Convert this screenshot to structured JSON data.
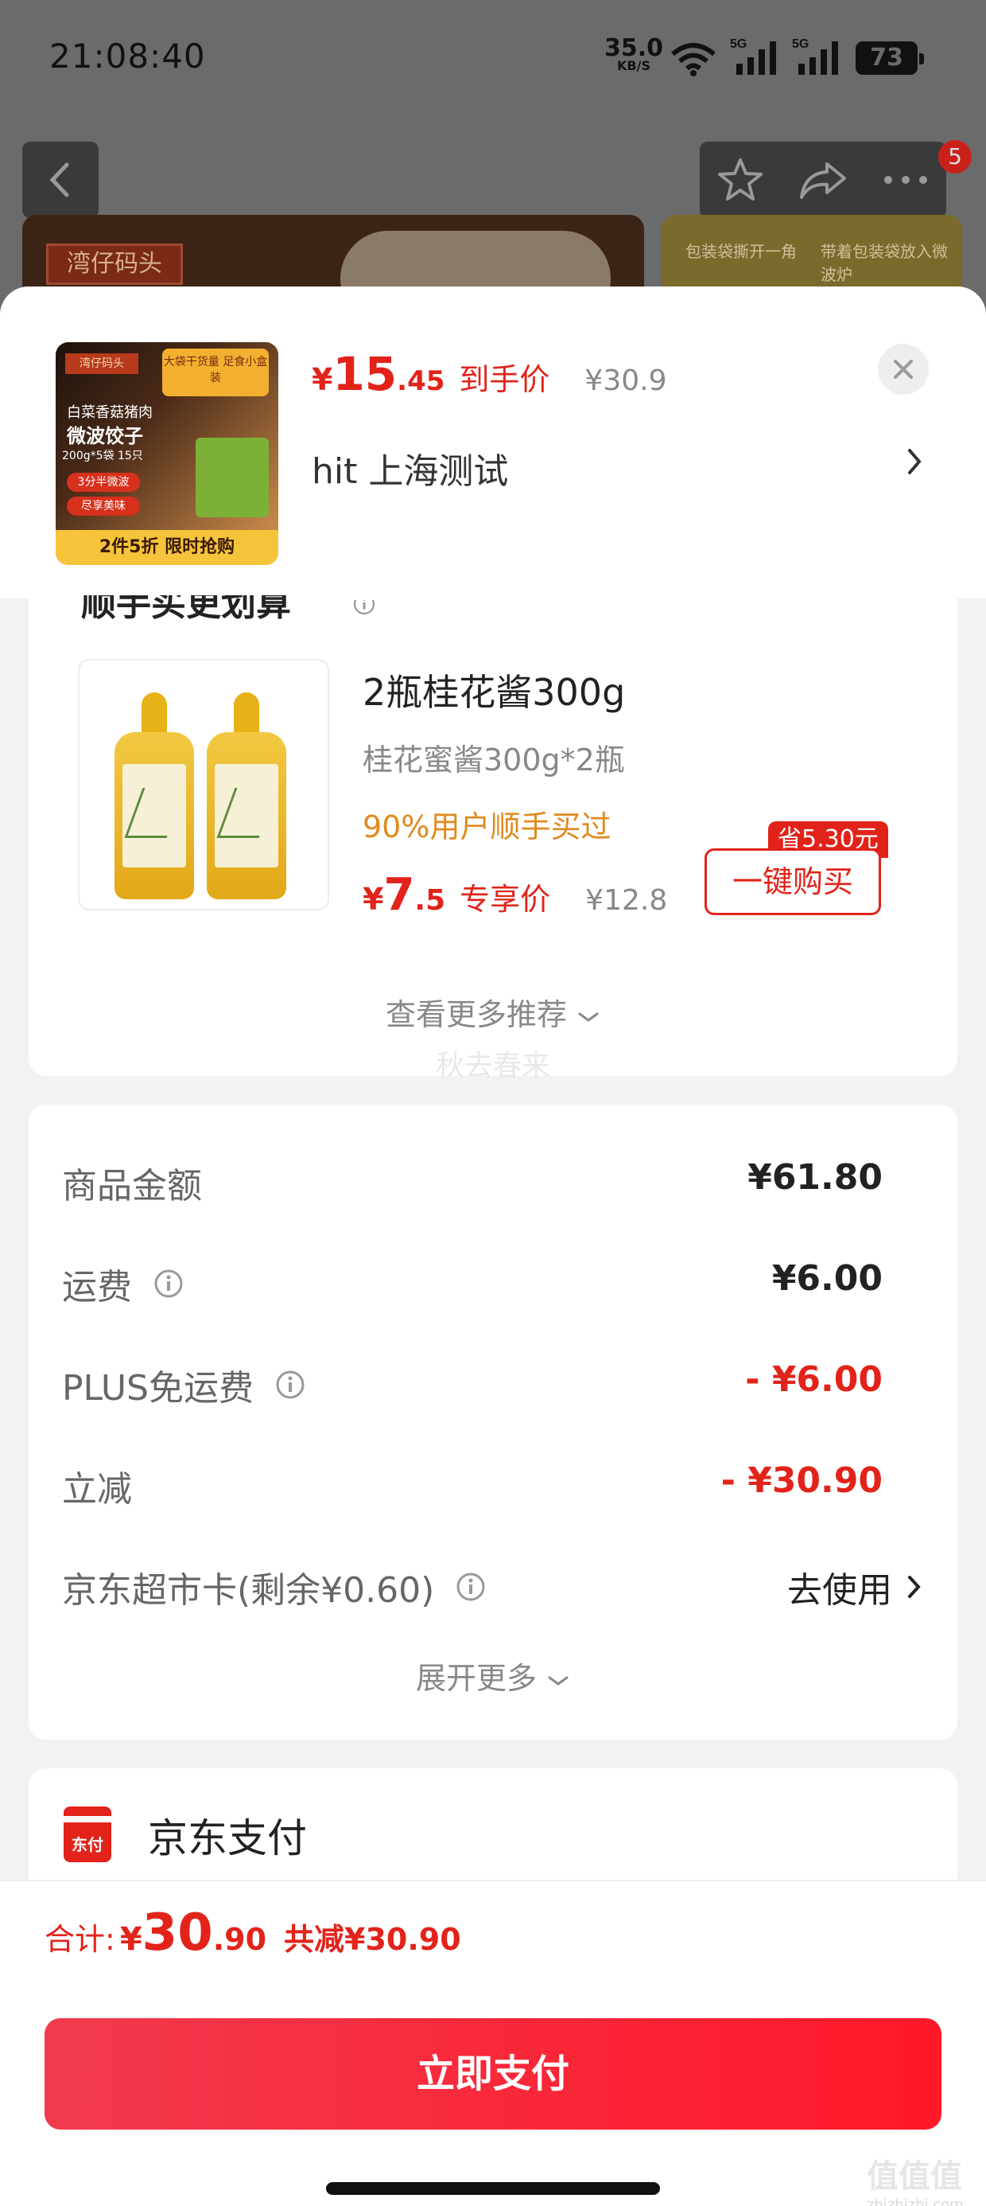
{
  "status_bar": {
    "time": "21:08:40",
    "net_speed": "35.0",
    "net_unit": "KB/S",
    "sim1": "5G",
    "sim2": "5G",
    "battery": "73"
  },
  "top_bar": {
    "notification_count": "5"
  },
  "background": {
    "brand_logo": "湾仔码头",
    "side_step1": "包装袋撕开一角",
    "side_step2": "带着包装袋放入微波炉"
  },
  "product": {
    "image_tag_brand": "湾仔码头",
    "image_title_line1": "白菜香菇猪肉",
    "image_title_line2": "微波饺子",
    "image_spec": "200g*5袋 15只",
    "image_tag1": "3分半微波",
    "image_tag2": "尽享美味",
    "image_badge": "大袋干货量 足食小盒装",
    "image_banner": "2件5折 限时抢购",
    "price_currency": "¥",
    "price_int": "15",
    "price_dec": ".45",
    "price_label": "到手价",
    "original_price": "¥30.9",
    "address": "hit  上海测试"
  },
  "recommend": {
    "section_title": "顺手买更划算",
    "item_name": "2瓶桂花酱300g",
    "item_spec": "桂花蜜酱300g*2瓶",
    "item_tip": "90%用户顺手买过",
    "price_currency": "¥",
    "price_int": "7",
    "price_dec": ".5",
    "price_label": "专享价",
    "original_price": "¥12.8",
    "save_tag": "省5.30元",
    "buy_label": "一键购买",
    "more_label": "查看更多推荐",
    "watermark": "秋去春来"
  },
  "summary": {
    "rows": [
      {
        "label": "商品金额",
        "value": "¥61.80"
      },
      {
        "label": "运费",
        "value": "¥6.00"
      },
      {
        "label": "PLUS免运费",
        "value": "- ¥6.00"
      },
      {
        "label": "立减",
        "value": "- ¥30.90"
      },
      {
        "label": "京东超市卡(剩余¥0.60)",
        "value": "去使用"
      }
    ],
    "expand_label": "展开更多"
  },
  "payment": {
    "icon_text": "东付",
    "method_name": "京东支付"
  },
  "footer": {
    "total_label": "合计:",
    "total_currency": "¥",
    "total_int": "30",
    "total_dec": ".90",
    "total_reduction": "共减¥30.90",
    "pay_button": "立即支付",
    "site_mark": "值值值",
    "site_url": "zhizhizhi.com"
  },
  "colors": {
    "accent_red": "#e2231a",
    "tip_orange": "#e08a1e",
    "muted_gray": "#888888"
  }
}
